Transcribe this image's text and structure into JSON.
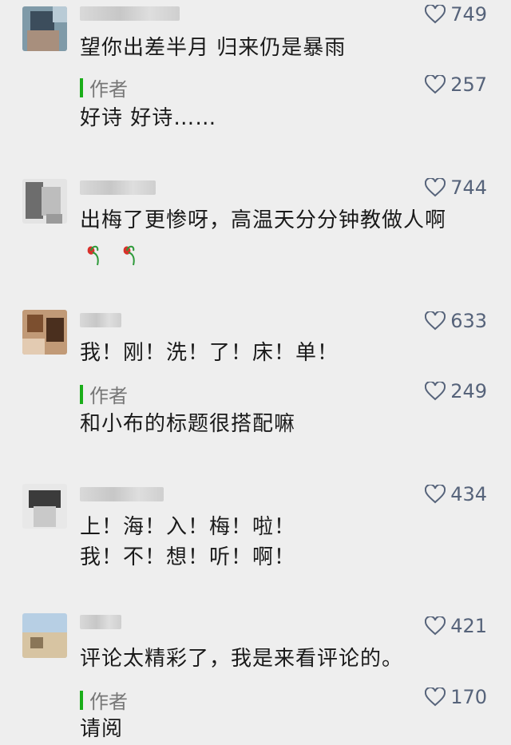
{
  "comments": [
    {
      "likes": "749",
      "text": "望你出差半月 归来仍是暴雨",
      "reply": {
        "tag": "作者",
        "likes": "257",
        "text": "好诗 好诗……"
      }
    },
    {
      "likes": "744",
      "text": "出梅了更惨呀，高温天分分钟教做人啊",
      "emojis": [
        "wilted-rose-icon",
        "wilted-rose-icon"
      ]
    },
    {
      "likes": "633",
      "text": "我！刚！洗！了！床！单！",
      "reply": {
        "tag": "作者",
        "likes": "249",
        "text": "和小布的标题很搭配嘛"
      }
    },
    {
      "likes": "434",
      "lines": [
        "上！海！入！梅！啦！",
        "我！不！想！听！啊！"
      ]
    },
    {
      "likes": "421",
      "text": "评论太精彩了，我是来看评论的。",
      "reply": {
        "tag": "作者",
        "likes": "170",
        "text": "请阅"
      }
    }
  ],
  "colors": {
    "background": "#eeeeee",
    "like_text": "#56637a",
    "author_accent": "#1aad19",
    "author_text": "#777777"
  }
}
